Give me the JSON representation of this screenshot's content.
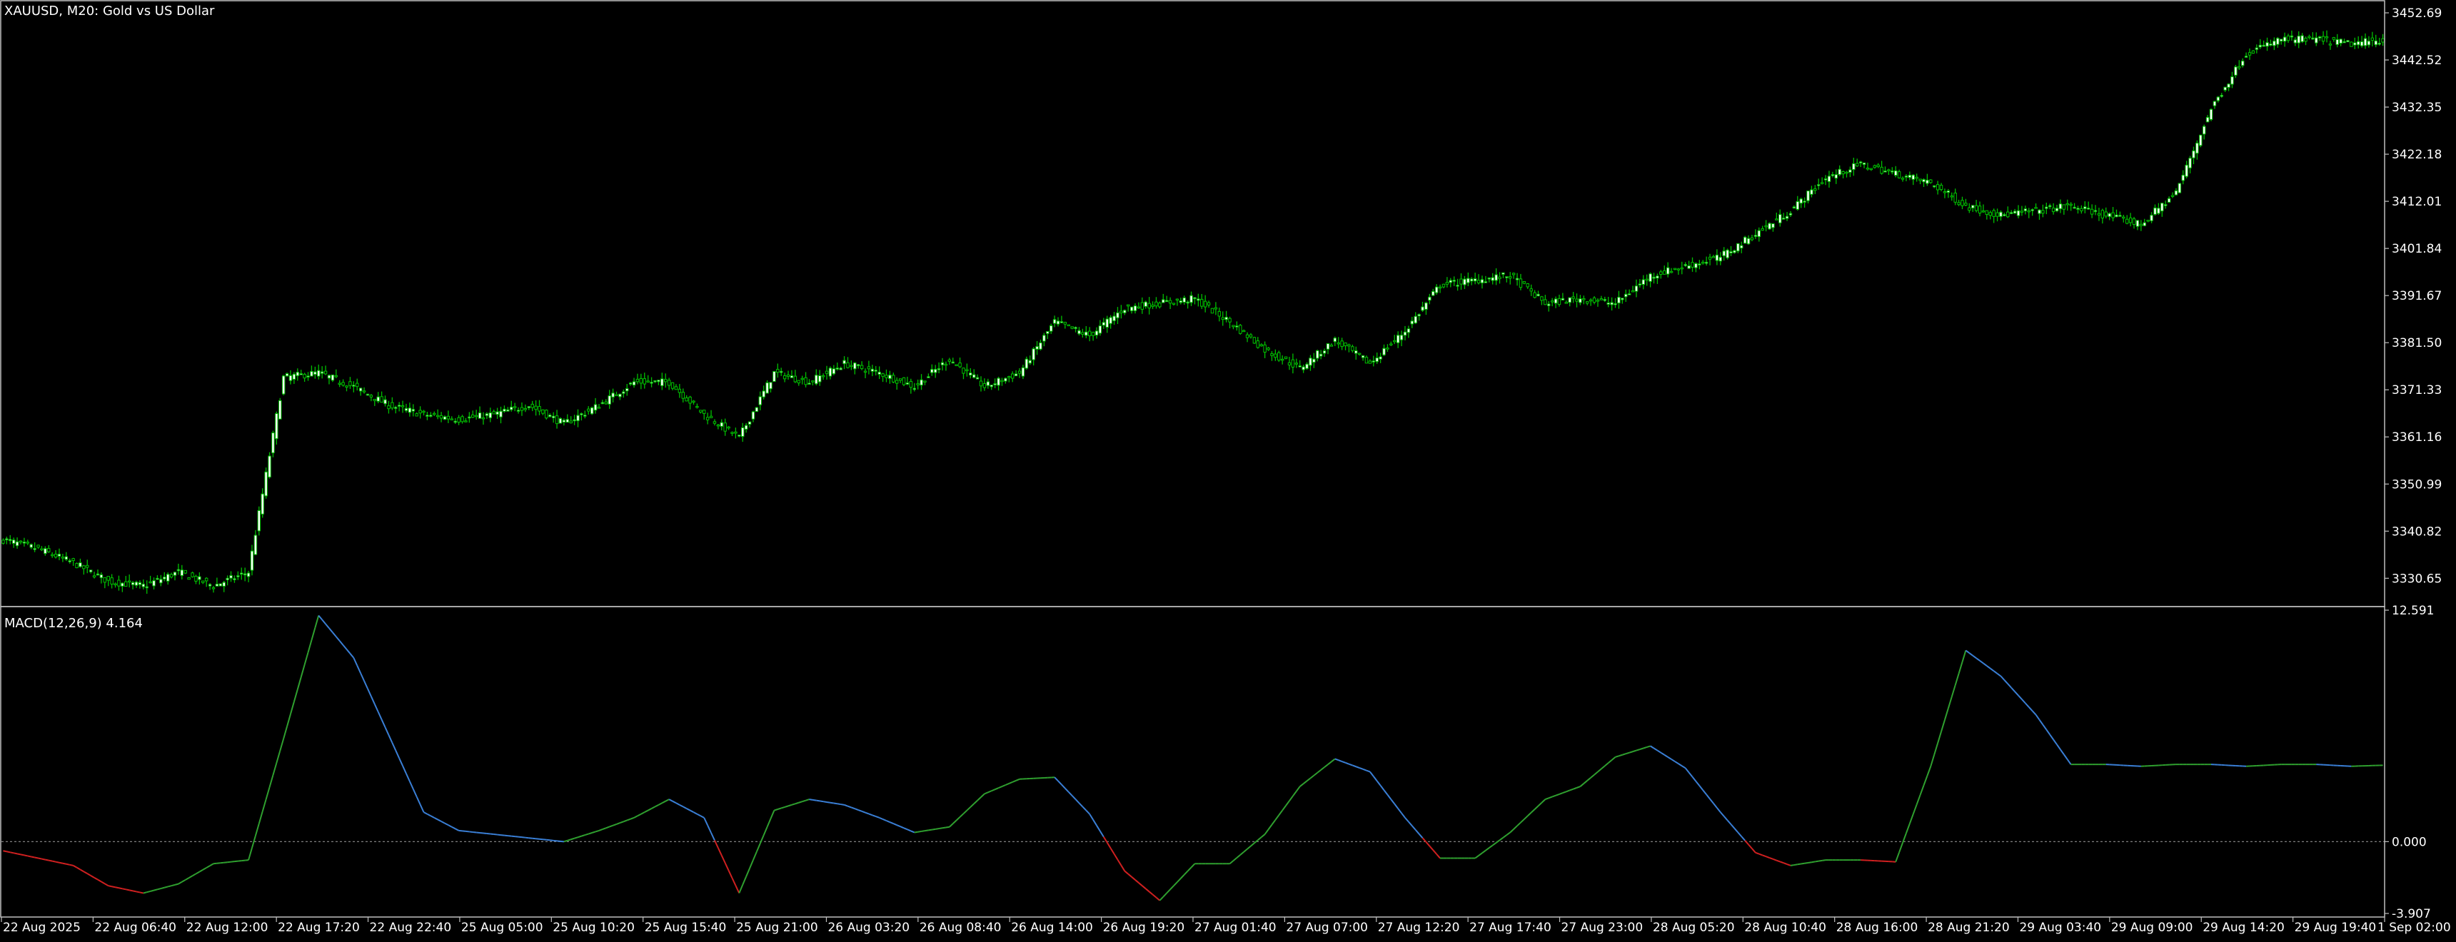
{
  "window": {
    "title": "XAUUSD, M20:  Gold vs US Dollar",
    "macd_label": "MACD(12,26,9) 4.164"
  },
  "colors": {
    "background": "#000000",
    "candle_bull": "#ffffff",
    "candle_bear": "#000000",
    "wick": "#00c000",
    "frame": "#c0c0c0",
    "macd_up": "#2fa02f",
    "macd_down": "#3a7fd6",
    "macd_neg": "#d02020",
    "zero_line": "#808080"
  },
  "chart_data": [
    {
      "type": "line",
      "title": "XAUUSD, M20:  Gold vs US Dollar",
      "series": [
        {
          "name": "XAUUSD",
          "x_index": [
            0,
            10,
            20,
            30,
            40,
            50,
            60,
            70,
            80,
            90,
            100,
            110,
            120,
            130,
            140,
            150,
            160,
            170,
            180,
            190,
            200,
            210,
            220,
            230,
            240,
            250,
            260,
            270,
            280,
            290,
            300,
            310,
            320,
            330,
            340,
            350,
            360,
            370,
            380,
            390,
            400,
            410,
            420,
            430,
            440,
            450,
            460,
            470,
            480,
            490,
            500,
            510,
            520,
            530,
            540,
            550,
            560,
            570,
            580,
            590,
            600,
            610,
            620,
            630,
            640,
            650,
            660,
            670,
            680
          ],
          "values": [
            3339,
            3337,
            3334,
            3330,
            3329,
            3332,
            3329,
            3332,
            3374,
            3375,
            3372,
            3368,
            3366,
            3365,
            3366,
            3368,
            3364,
            3368,
            3373,
            3373,
            3366,
            3361,
            3375,
            3373,
            3377,
            3375,
            3372,
            3378,
            3372,
            3375,
            3386,
            3383,
            3389,
            3390,
            3391,
            3386,
            3380,
            3376,
            3382,
            3377,
            3384,
            3394,
            3395,
            3396,
            3390,
            3391,
            3390,
            3396,
            3398,
            3400,
            3405,
            3410,
            3417,
            3420,
            3418,
            3416,
            3411,
            3409,
            3410,
            3411,
            3409,
            3407,
            3414,
            3432,
            3444,
            3447,
            3447,
            3446,
            3447
          ]
        }
      ],
      "y_ticks": [
        "3452.69",
        "3442.52",
        "3432.35",
        "3422.18",
        "3412.01",
        "3401.84",
        "3391.67",
        "3381.50",
        "3371.33",
        "3361.16",
        "3350.99",
        "3340.82",
        "3330.65"
      ],
      "ylim": [
        3325,
        3455
      ]
    },
    {
      "type": "line",
      "title": "MACD(12,26,9) 4.164",
      "series": [
        {
          "name": "MACD",
          "x_index": [
            0,
            10,
            20,
            30,
            40,
            50,
            60,
            70,
            80,
            90,
            100,
            110,
            120,
            130,
            140,
            150,
            160,
            170,
            180,
            190,
            200,
            210,
            220,
            230,
            240,
            250,
            260,
            270,
            280,
            290,
            300,
            310,
            320,
            330,
            340,
            350,
            360,
            370,
            380,
            390,
            400,
            410,
            420,
            430,
            440,
            450,
            460,
            470,
            480,
            490,
            500,
            510,
            520,
            530,
            540,
            550,
            560,
            570,
            580,
            590,
            600,
            610,
            620,
            630,
            640,
            650,
            660,
            670,
            680
          ],
          "values": [
            -0.5,
            -0.9,
            -1.3,
            -2.4,
            -2.8,
            -2.3,
            -1.2,
            -1.0,
            5.6,
            12.3,
            10.0,
            5.8,
            1.6,
            0.6,
            0.4,
            0.2,
            0.0,
            0.6,
            1.3,
            2.3,
            1.3,
            -2.8,
            1.7,
            2.3,
            2.0,
            1.3,
            0.5,
            0.8,
            2.6,
            3.4,
            3.5,
            1.5,
            -1.6,
            -3.2,
            -1.2,
            -1.2,
            0.4,
            3.0,
            4.5,
            3.8,
            1.3,
            -0.9,
            -0.9,
            0.5,
            2.3,
            3.0,
            4.6,
            5.2,
            4.0,
            1.6,
            -0.6,
            -1.3,
            -1.0,
            -1.0,
            -1.1,
            4.1,
            10.4,
            9.0,
            6.9,
            4.2,
            4.2,
            4.1,
            4.2,
            4.2,
            4.1,
            4.2,
            4.2,
            4.1,
            4.16
          ]
        }
      ],
      "y_ticks": [
        "12.591",
        "0.000",
        "-3.907"
      ],
      "ylim": [
        -3.907,
        12.591
      ]
    }
  ],
  "x_ticks": [
    "22 Aug 2025",
    "22 Aug 06:40",
    "22 Aug 12:00",
    "22 Aug 17:20",
    "22 Aug 22:40",
    "25 Aug 05:00",
    "25 Aug 10:20",
    "25 Aug 15:40",
    "25 Aug 21:00",
    "26 Aug 03:20",
    "26 Aug 08:40",
    "26 Aug 14:00",
    "26 Aug 19:20",
    "27 Aug 01:40",
    "27 Aug 07:00",
    "27 Aug 12:20",
    "27 Aug 17:40",
    "27 Aug 23:00",
    "28 Aug 05:20",
    "28 Aug 10:40",
    "28 Aug 16:00",
    "28 Aug 21:20",
    "29 Aug 03:40",
    "29 Aug 09:00",
    "29 Aug 14:20",
    "29 Aug 19:40",
    "1 Sep 02:00"
  ]
}
